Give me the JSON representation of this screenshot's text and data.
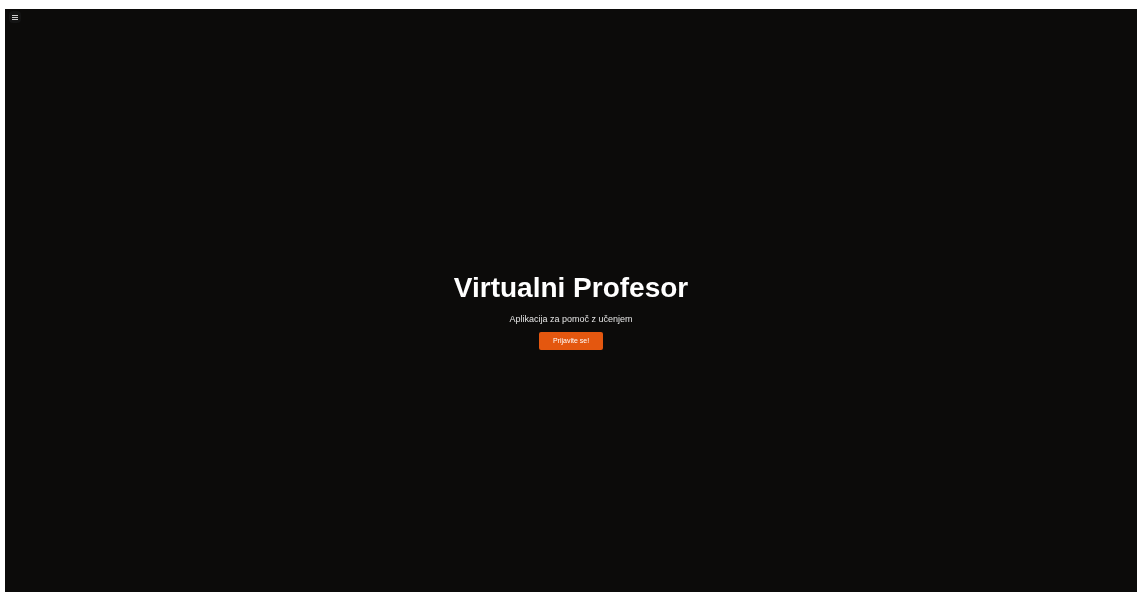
{
  "hero": {
    "title": "Virtualni Profesor",
    "subtitle": "Aplikacija za pomoč z učenjem",
    "button": "Prijavite se!"
  }
}
